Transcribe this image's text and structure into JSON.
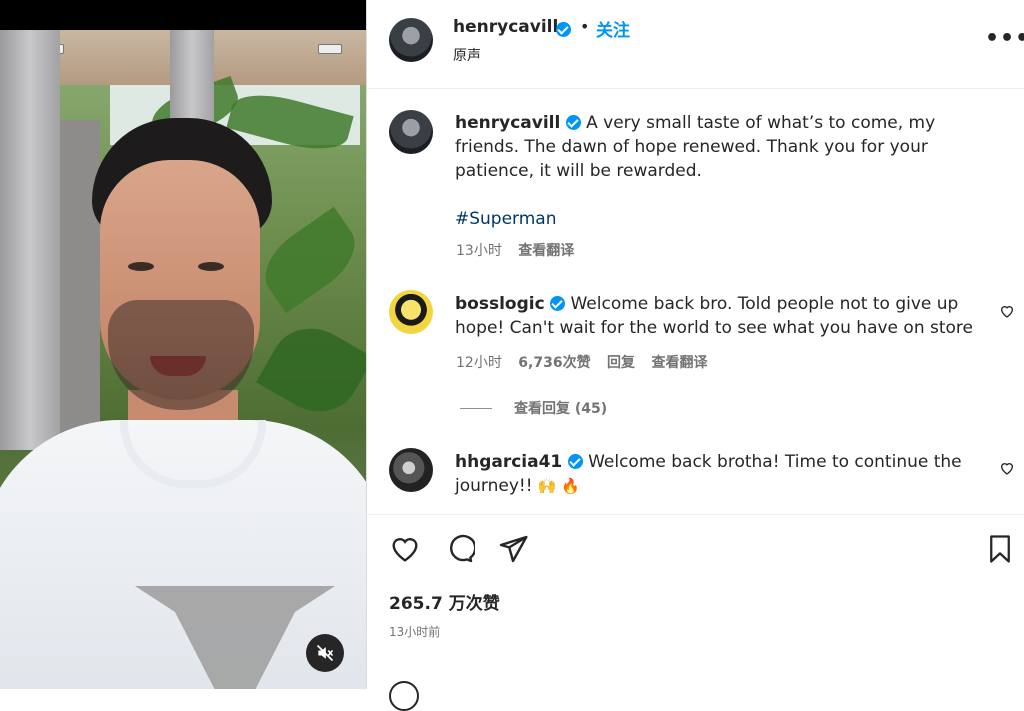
{
  "post": {
    "username": "henrycavill",
    "follow_label": "关注",
    "audio_label": "原声",
    "more_label": "•••",
    "caption": "A very small taste of what’s to come, my friends. The dawn of hope renewed. Thank you for your patience, it will be rewarded.",
    "hashtag": "#Superman",
    "caption_time": "13小时",
    "caption_translate": "查看翻译",
    "likes": "265.7 万次赞",
    "posted_time": "13小时前"
  },
  "comments": [
    {
      "username": "bosslogic",
      "text": "Welcome back bro. Told people not to give up hope! Can't wait for the world to see what you have on store",
      "time": "12小时",
      "likes": "6,736次赞",
      "reply": "回复",
      "translate": "查看翻译",
      "view_replies": "查看回复 (45)"
    },
    {
      "username": "hhgarcia41",
      "text": "Welcome back brotha! Time to continue the journey!!",
      "emojis": "🙌 🔥"
    }
  ],
  "icons": {
    "mute": "speaker-muted-icon",
    "like": "heart-icon",
    "comment": "comment-bubble-icon",
    "share": "paper-plane-icon",
    "save": "bookmark-icon",
    "verified": "verified-badge-icon"
  },
  "colors": {
    "accent": "#0095f6",
    "text": "#262626",
    "muted": "#737373",
    "hashtag": "#00376b"
  }
}
